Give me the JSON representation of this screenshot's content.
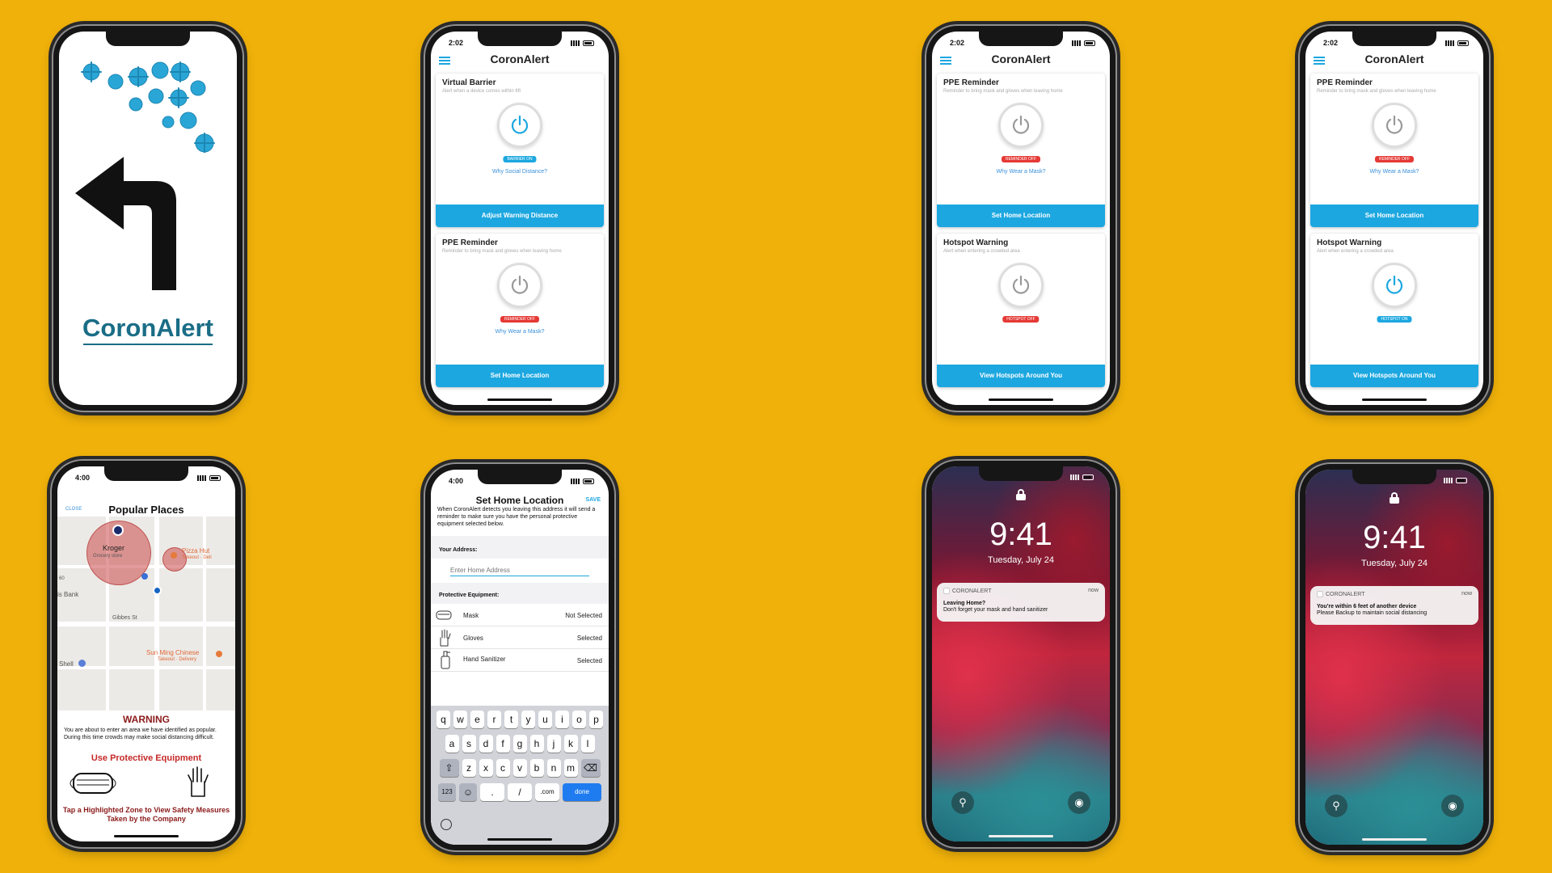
{
  "colors": {
    "background": "#F0B10A",
    "accent": "#1CA7E0",
    "off": "#E53935",
    "brand": "#1a6d86",
    "warning": "#8B1A1A"
  },
  "splash": {
    "logo": "CoronAlert"
  },
  "app_title": "CoronAlert",
  "screen_barrier": {
    "time": "2:02",
    "card1": {
      "title": "Virtual Barrier",
      "desc": "Alert when a device comes within 6ft",
      "pill": "BARRIER ON",
      "link": "Why Social Distance?",
      "button": "Adjust Warning Distance"
    },
    "card2": {
      "title": "PPE Reminder",
      "desc": "Reminder to bring mask and gloves when leaving home",
      "pill": "REMINDER OFF",
      "link": "Why Wear a Mask?",
      "button": "Set Home Location"
    }
  },
  "screen_hotspot_off": {
    "time": "2:02",
    "card1": {
      "title": "PPE Reminder",
      "desc": "Reminder to bring mask and gloves when leaving home",
      "pill": "REMINDER OFF",
      "link": "Why Wear a Mask?",
      "button": "Set Home Location"
    },
    "card2": {
      "title": "Hotspot Warning",
      "desc": "Alert when entering a crowded area",
      "pill": "HOTSPOT OFF",
      "button": "View Hotspots Around You"
    }
  },
  "screen_hotspot_on": {
    "time": "2:02",
    "card1": {
      "title": "PPE Reminder",
      "desc": "Reminder to bring mask and gloves when leaving home",
      "pill": "REMINDER OFF",
      "link": "Why Wear a Mask?",
      "button": "Set Home Location"
    },
    "card2": {
      "title": "Hotspot Warning",
      "desc": "Alert when entering a crowded area",
      "pill": "HOTSPOT ON",
      "button": "View Hotspots Around You"
    }
  },
  "popular": {
    "time": "4:00",
    "close": "CLOSE",
    "title": "Popular Places",
    "map": {
      "kroger": "Kroger",
      "kroger_sub": "Grocery store",
      "pizza": "Pizza Hut",
      "pizza_sub": "Takeout · Deli",
      "bank": "is Bank",
      "gibbes": "Gibbes St",
      "shell": "Shell",
      "sunming": "Sun Ming Chinese",
      "sunming_sub": "Takeout · Delivery",
      "route": "60"
    },
    "warning": "WARNING",
    "warning_text": "You are about to enter an area we have identified as popular. During this time crowds may make social distancing difficult.",
    "ppe_title": "Use Protective Equipment",
    "tap_text": "Tap a Highlighted Zone to View Safety Measures Taken by the Company"
  },
  "sethome": {
    "time": "4:00",
    "title": "Set Home Location",
    "save": "SAVE",
    "intro": "When CoronAlert detects you leaving this address it will send a reminder to make sure you have the personal protective equipment selected below.",
    "address_label": "Your Address:",
    "address_placeholder": "Enter Home Address",
    "equipment_label": "Protective Equipment:",
    "equipment": [
      {
        "name": "Mask",
        "status": "Not Selected"
      },
      {
        "name": "Gloves",
        "status": "Selected"
      },
      {
        "name": "Hand Sanitizer",
        "status": "Selected"
      }
    ],
    "keys_row1": [
      "q",
      "w",
      "e",
      "r",
      "t",
      "y",
      "u",
      "i",
      "o",
      "p"
    ],
    "keys_row2": [
      "a",
      "s",
      "d",
      "f",
      "g",
      "h",
      "j",
      "k",
      "l"
    ],
    "keys_row3": [
      "z",
      "x",
      "c",
      "v",
      "b",
      "n",
      "m"
    ],
    "key_123": "123",
    "key_dot": ".",
    "key_slash": "/",
    "key_com": ".com",
    "key_done": "done"
  },
  "lock1": {
    "time": "9:41",
    "date": "Tuesday, July 24",
    "app": "CORONALERT",
    "when": "now",
    "title": "Leaving Home?",
    "body": "Don't forget your mask and hand sanitizer"
  },
  "lock2": {
    "time": "9:41",
    "date": "Tuesday, July 24",
    "app": "CORONALERT",
    "when": "now",
    "title": "You're within 6 feet of another device",
    "body": "Please Backup to maintain social distancing"
  }
}
